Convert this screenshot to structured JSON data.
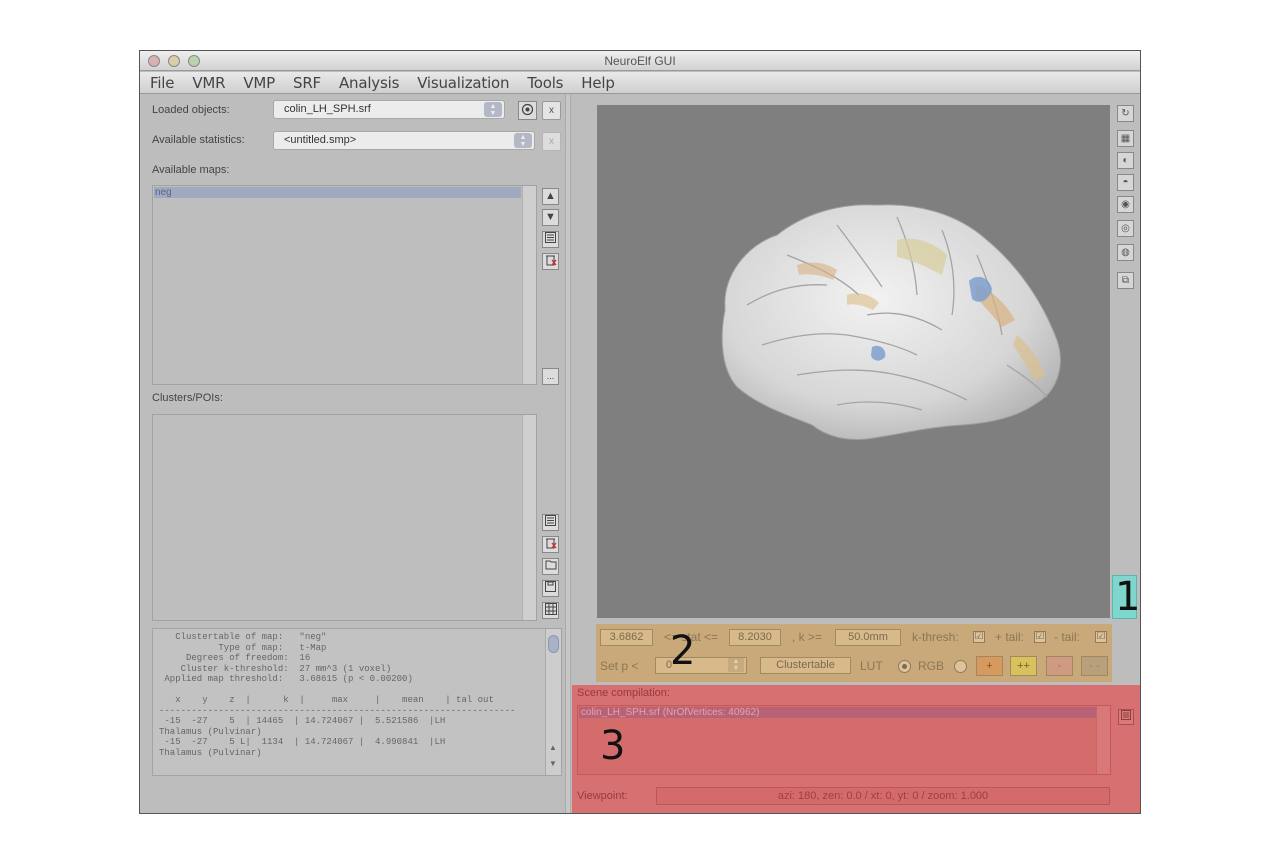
{
  "window": {
    "title": "NeuroElf GUI"
  },
  "menu": [
    "File",
    "VMR",
    "VMP",
    "SRF",
    "Analysis",
    "Visualization",
    "Tools",
    "Help"
  ],
  "left_panel": {
    "loaded_objects_label": "Loaded objects:",
    "loaded_objects_value": "colin_LH_SPH.srf",
    "close_button": "x",
    "available_statistics_label": "Available statistics:",
    "available_statistics_value": "<untitled.smp>",
    "available_maps_label": "Available maps:",
    "maps": [
      "neg"
    ],
    "more_button": "...",
    "clusters_label": "Clusters/POIs:",
    "cluster_output_lines": [
      "   Clustertable of map:   \"neg\"",
      "           Type of map:   t-Map",
      "     Degrees of freedom:  16",
      "    Cluster k-threshold:  27 mm^3 (1 voxel)",
      " Applied map threshold:   3.68615 (p < 0.00200)",
      "",
      "   x    y    z  |      k  |     max     |    mean    | tal out",
      "------------------------------------------------------------------",
      " -15  -27    5  | 14465  | 14.724067 |  5.521586  |LH",
      "Thalamus (Pulvinar)",
      " -15  -27    5 L|  1134  | 14.724067 |  4.990841  |LH",
      "Thalamus (Pulvinar)"
    ]
  },
  "stats_bar": {
    "lower_threshold": "3.6862",
    "stat_label": "<= stat <=",
    "upper_threshold": "8.2030",
    "k_label": ", k >=",
    "k_value": "50.0mm",
    "k_thresh_label": "k-thresh:",
    "pos_tail_label": "+ tail:",
    "neg_tail_label": "- tail:",
    "set_p_label": "Set p <",
    "p_value": "0",
    "clustertable_button": "Clustertable",
    "lut_label": "LUT",
    "rgb_label": "RGB",
    "lut_buttons": [
      "+",
      "++",
      "-",
      "- -"
    ],
    "check_mark": "☑"
  },
  "scene": {
    "label": "Scene compilation:",
    "items": [
      "colin_LH_SPH.srf (NrOfVertices: 40962)"
    ],
    "viewpoint_label": "Viewpoint:",
    "viewpoint_value": "azi: 180, zen: 0.0 / xt: 0, yt: 0 / zoom: 1.000"
  },
  "annotations": [
    "1",
    "2",
    "3"
  ],
  "colors": {
    "stats_panel": "#c9a979",
    "scene_panel": "#d67071",
    "highlight_button": "#7fd6cc",
    "canvas": "#7f7f7f"
  },
  "icons": {
    "right_toolbar": [
      "rotate-icon",
      "layout-icon",
      "sagittal-view-icon",
      "coronal-view-icon",
      "axial-view-icon",
      "render-icon",
      "surface-view-icon",
      "undock-icon"
    ],
    "map_buttons": [
      "move-up-icon",
      "move-down-icon",
      "properties-icon",
      "delete-icon"
    ],
    "cluster_buttons": [
      "properties-icon",
      "delete-icon",
      "open-folder-icon",
      "save-icon",
      "table-icon"
    ]
  }
}
